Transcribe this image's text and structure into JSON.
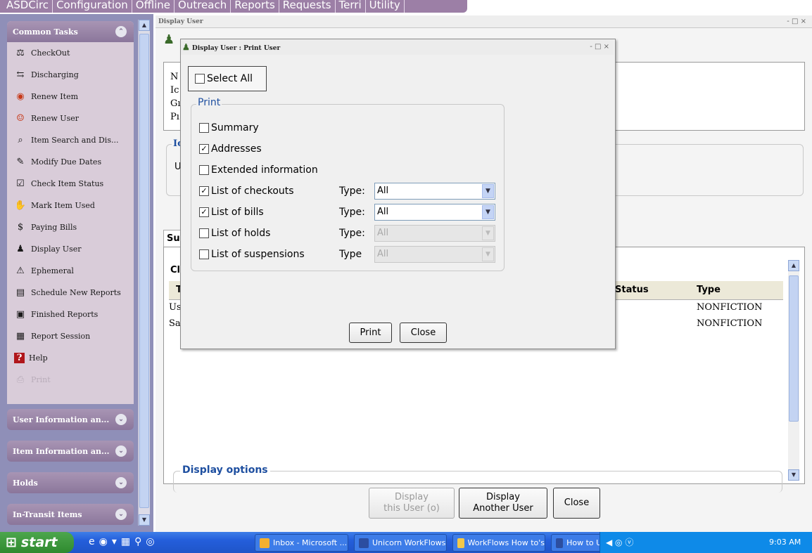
{
  "menu": [
    "ASDCirc",
    "Configuration",
    "Offline",
    "Outreach",
    "Reports",
    "Requests",
    "Terri",
    "Utility"
  ],
  "tasks_panel": {
    "title": "Common Tasks",
    "items": [
      {
        "label": "CheckOut",
        "icon": "checkout-icon"
      },
      {
        "label": "Discharging",
        "icon": "discharging-icon"
      },
      {
        "label": "Renew Item",
        "icon": "renew-item-icon"
      },
      {
        "label": "Renew User",
        "icon": "renew-user-icon"
      },
      {
        "label": "Item Search and Dis...",
        "icon": "item-search-icon"
      },
      {
        "label": "Modify Due Dates",
        "icon": "modify-due-dates-icon"
      },
      {
        "label": "Check Item Status",
        "icon": "check-item-status-icon"
      },
      {
        "label": "Mark Item Used",
        "icon": "mark-item-used-icon"
      },
      {
        "label": "Paying Bills",
        "icon": "paying-bills-icon"
      },
      {
        "label": "Display User",
        "icon": "display-user-icon"
      },
      {
        "label": "Ephemeral",
        "icon": "ephemeral-icon"
      },
      {
        "label": "Schedule New Reports",
        "icon": "schedule-reports-icon"
      },
      {
        "label": "Finished Reports",
        "icon": "finished-reports-icon"
      },
      {
        "label": "Report Session",
        "icon": "report-session-icon"
      },
      {
        "label": "Help",
        "icon": "help-icon"
      },
      {
        "label": "Print",
        "icon": "print-icon",
        "disabled": true
      }
    ]
  },
  "groups": [
    "User Information an...",
    "Item Information an...",
    "Holds",
    "In-Transit Items"
  ],
  "main_window": {
    "title": "Display User",
    "controls": "-  □  ×",
    "user_labels": [
      "N",
      "Ic",
      "Gı",
      "Pı"
    ],
    "fieldset_label": "Ic",
    "fieldset_text": "U",
    "tab_label": "Su",
    "section_label": "Cl",
    "grid": {
      "col_first": "T",
      "col_status": "Status",
      "col_type": "Type",
      "rows": [
        {
          "first": "Us",
          "type": "NONFICTION"
        },
        {
          "first": "Sa",
          "type": "NONFICTION"
        }
      ]
    },
    "display_options": "Display options",
    "buttons": {
      "display_this_user": "Display\nthis User (o)",
      "display_another_user": "Display\nAnother User",
      "close": "Close"
    }
  },
  "dialog": {
    "title": "Display User : Print User",
    "controls": "-  □  ×",
    "select_all": "Select All",
    "select_all_checked": false,
    "print_group_label": "Print",
    "options": [
      {
        "label": "Summary",
        "checked": false
      },
      {
        "label": "Addresses",
        "checked": true
      },
      {
        "label": "Extended information",
        "checked": false
      },
      {
        "label": "List of checkouts",
        "checked": true,
        "type_label": "Type:",
        "type_value": "All",
        "enabled": true
      },
      {
        "label": "List of bills",
        "checked": true,
        "type_label": "Type:",
        "type_value": "All",
        "enabled": true
      },
      {
        "label": "List of holds",
        "checked": false,
        "type_label": "Type:",
        "type_value": "All",
        "enabled": false
      },
      {
        "label": "List of suspensions",
        "checked": false,
        "type_label": "Type",
        "type_value": "All",
        "enabled": false
      }
    ],
    "print_button": "Print",
    "close_button": "Close"
  },
  "taskbar": {
    "start": "start",
    "windows": [
      {
        "label": "Inbox - Microsoft ...",
        "icon": "outlook-icon"
      },
      {
        "label": "Unicorn WorkFlows",
        "icon": "workflows-icon"
      },
      {
        "label": "WorkFlows How to's",
        "icon": "folder-icon"
      },
      {
        "label": "How to Use the Us...",
        "icon": "word-icon"
      }
    ],
    "clock": "9:03 AM"
  }
}
